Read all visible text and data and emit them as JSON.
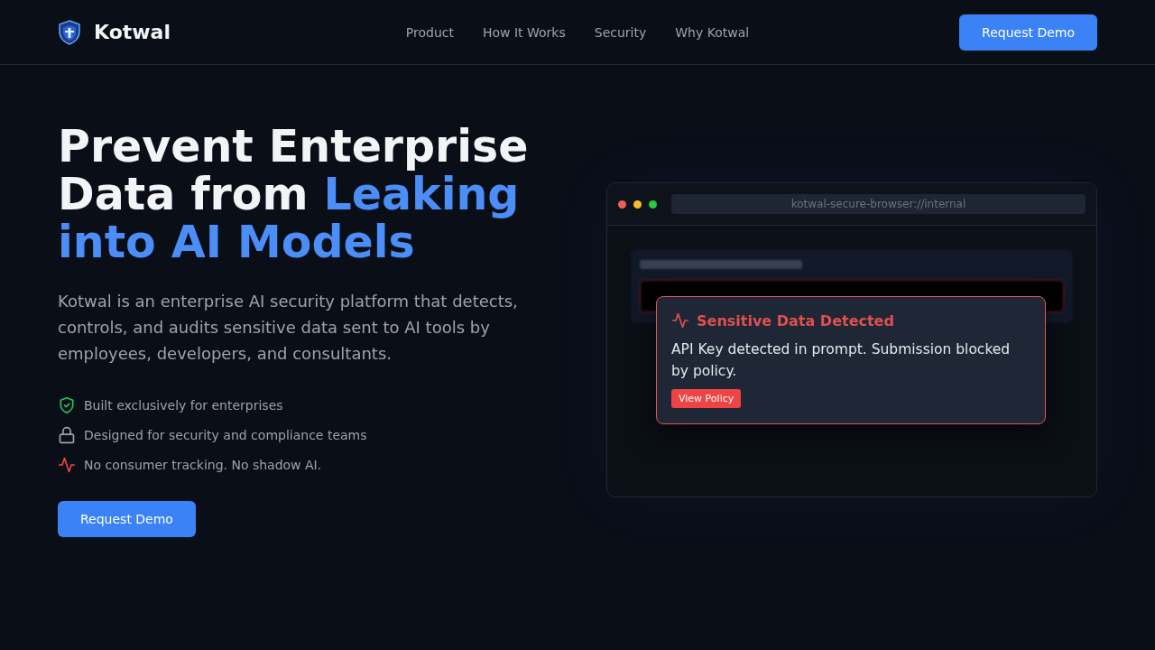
{
  "header": {
    "brand": "Kotwal",
    "nav": [
      "Product",
      "How It Works",
      "Security",
      "Why Kotwal"
    ],
    "cta": "Request Demo"
  },
  "hero": {
    "title_lines": [
      [
        {
          "text": "Prevent Enterprise",
          "highlight": false
        }
      ],
      [
        {
          "text": "Data from ",
          "highlight": false
        },
        {
          "text": "Leaking",
          "highlight": true
        }
      ],
      [
        {
          "text": "into AI Models",
          "highlight": true
        }
      ]
    ],
    "description": "Kotwal is an enterprise AI security platform that detects, controls, and audits sensitive data sent to AI tools by employees, developers, and consultants.",
    "features": [
      {
        "kind": "shield",
        "text": "Built exclusively for enterprises",
        "color": "#22c55e"
      },
      {
        "kind": "lock",
        "text": "Designed for security and compliance teams",
        "color": "#9ca3af"
      },
      {
        "kind": "pulse",
        "text": "No consumer tracking. No shadow AI.",
        "color": "#ef4444"
      }
    ],
    "cta": "Request Demo"
  },
  "browser": {
    "url": "kotwal-secure-browser://internal",
    "alert": {
      "title": "Sensitive Data Detected",
      "message": "API Key detected in prompt. Submission blocked by policy.",
      "action": "View Policy"
    }
  }
}
